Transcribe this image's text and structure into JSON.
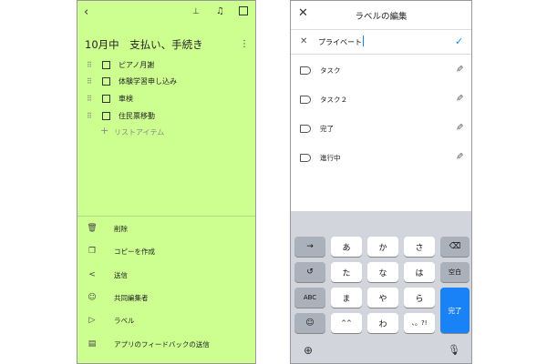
{
  "left_panel": {
    "note_title": "10月中　支払い、手続き",
    "checklist": [
      "ピアノ月謝",
      "体験学習申し込み",
      "車検",
      "住民票移動"
    ],
    "add_item_placeholder": "リストアイテム",
    "menu": [
      {
        "icon": "trash-icon",
        "label": "削除"
      },
      {
        "icon": "copy-icon",
        "label": "コピーを作成"
      },
      {
        "icon": "share-icon",
        "label": "送信"
      },
      {
        "icon": "add-person-icon",
        "label": "共同編集者"
      },
      {
        "icon": "label-icon",
        "label": "ラベル"
      },
      {
        "icon": "feedback-icon",
        "label": "アプリのフィードバックの送信"
      }
    ]
  },
  "right_panel": {
    "title": "ラベルの編集",
    "input_value": "プライベート",
    "labels": [
      "タスク",
      "タスク２",
      "完了",
      "進行中"
    ],
    "keyboard": {
      "row1": [
        "→",
        "あ",
        "か",
        "さ",
        "⌫"
      ],
      "row2": [
        "↺",
        "た",
        "な",
        "は",
        "空白"
      ],
      "row3": [
        "ABC",
        "ま",
        "や",
        "ら",
        "完了"
      ],
      "row4": [
        "☺",
        "^^",
        "わ",
        "、。?!"
      ]
    }
  },
  "colors": {
    "note_background": "#ccff90",
    "accent": "#1a82f7"
  }
}
